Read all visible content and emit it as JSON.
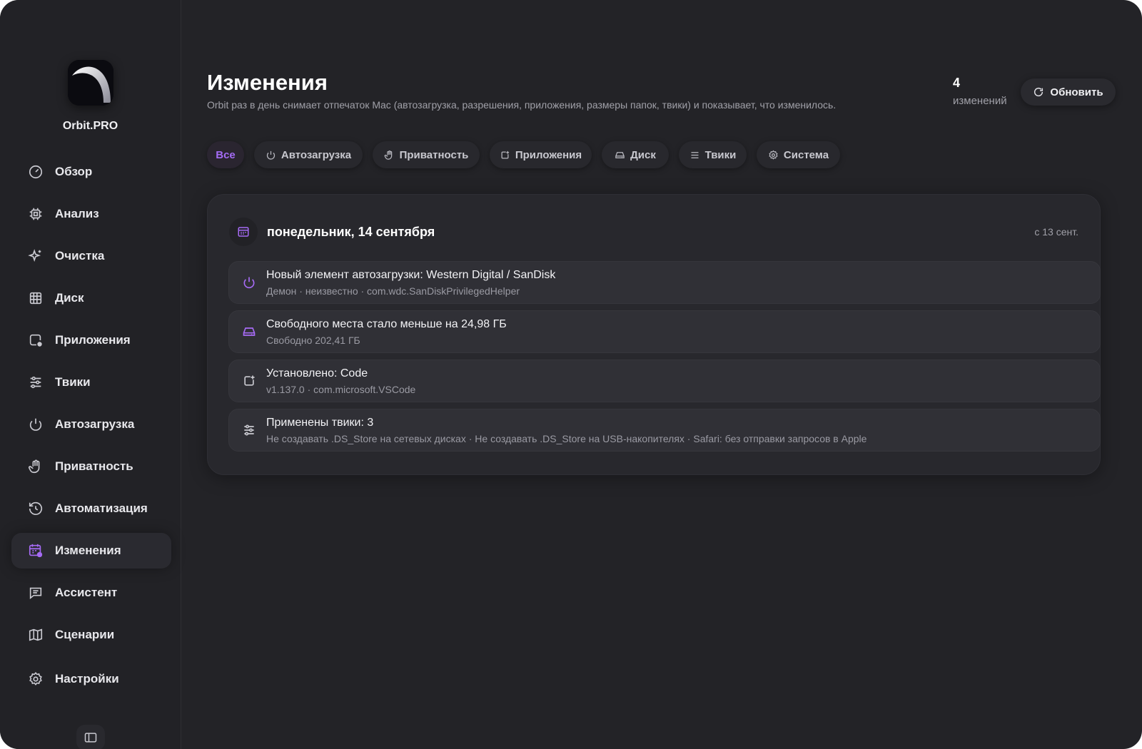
{
  "app": {
    "name": "Orbit.PRO"
  },
  "sidebar": {
    "items": [
      {
        "label": "Обзор",
        "icon": "gauge-icon"
      },
      {
        "label": "Анализ",
        "icon": "cpu-icon"
      },
      {
        "label": "Очистка",
        "icon": "sparkles-icon"
      },
      {
        "label": "Диск",
        "icon": "grid-icon"
      },
      {
        "label": "Приложения",
        "icon": "app-check-icon"
      },
      {
        "label": "Твики",
        "icon": "sliders-icon"
      },
      {
        "label": "Автозагрузка",
        "icon": "power-icon"
      },
      {
        "label": "Приватность",
        "icon": "hand-icon"
      },
      {
        "label": "Автоматизация",
        "icon": "history-icon"
      },
      {
        "label": "Изменения",
        "icon": "calendar-changes-icon",
        "active": true
      },
      {
        "label": "Ассистент",
        "icon": "chat-icon"
      },
      {
        "label": "Сценарии",
        "icon": "map-icon"
      },
      {
        "label": "Настройки",
        "icon": "gear-icon"
      }
    ]
  },
  "header": {
    "title": "Изменения",
    "subtitle": "Orbit раз в день снимает отпечаток Mac (автозагрузка, разрешения, приложения, размеры папок, твики) и показывает, что изменилось.",
    "count_value": "4",
    "count_label": "изменений",
    "refresh_label": "Обновить"
  },
  "filters": [
    {
      "label": "Все",
      "icon": "",
      "active": true
    },
    {
      "label": "Автозагрузка",
      "icon": "power-icon"
    },
    {
      "label": "Приватность",
      "icon": "hand-icon"
    },
    {
      "label": "Приложения",
      "icon": "app-icon"
    },
    {
      "label": "Диск",
      "icon": "drive-icon"
    },
    {
      "label": "Твики",
      "icon": "sliders-icon"
    },
    {
      "label": "Система",
      "icon": "gear-icon"
    }
  ],
  "day": {
    "title": "понедельник, 14 сентября",
    "since": "с 13 сент.",
    "entries": [
      {
        "title": "Новый элемент автозагрузки: Western Digital / SanDisk",
        "subtitle": "Демон · неизвестно · com.wdc.SanDiskPrivilegedHelper",
        "icon": "power-icon",
        "accent": true
      },
      {
        "title": "Свободного места стало меньше на 24,98 ГБ",
        "subtitle": "Свободно 202,41 ГБ",
        "icon": "drive-icon",
        "accent": true
      },
      {
        "title": "Установлено: Code",
        "subtitle": "v1.137.0 · com.microsoft.VSCode",
        "icon": "app-icon",
        "accent": false
      },
      {
        "title": "Применены твики: 3",
        "subtitle": "Не создавать .DS_Store на сетевых дисках · Не создавать .DS_Store на USB-накопителях · Safari: без отправки запросов в Apple",
        "icon": "sliders-icon",
        "accent": false
      }
    ]
  },
  "colors": {
    "accent": "#a66bf5",
    "background": "#232327",
    "card": "#28282d"
  }
}
